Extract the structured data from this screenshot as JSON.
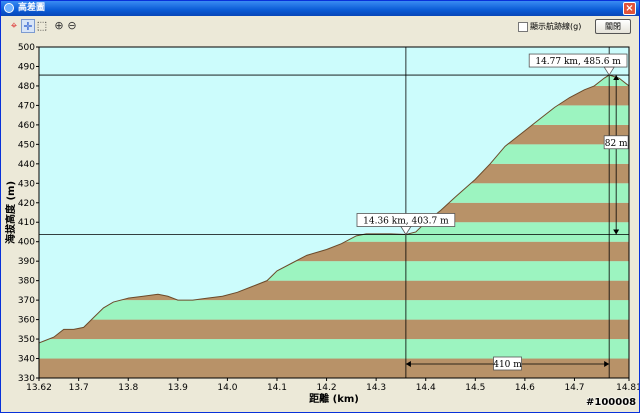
{
  "window": {
    "title": "高差圖",
    "close_glyph": "×"
  },
  "toolbar": {
    "tools": [
      {
        "name": "crosshair-red-icon",
        "glyph": "⌖"
      },
      {
        "name": "crosshair-blue-icon",
        "glyph": "✛"
      },
      {
        "name": "select-region-icon",
        "glyph": "⬚"
      },
      {
        "name": "zoom-in-icon",
        "glyph": "⊕"
      },
      {
        "name": "zoom-out-icon",
        "glyph": "⊖"
      }
    ],
    "checkbox_label": "顯示航跡線(g)",
    "close_label": "關閉"
  },
  "watermark": "#100008",
  "colors": {
    "sky": "#ccfcfc",
    "band_brown": "#b89268",
    "band_green": "#9cf4c0",
    "terrain_edge": "#6b4a2a"
  },
  "chart_data": {
    "type": "area",
    "title": "",
    "xlabel": "距離 (km)",
    "ylabel": "海拔高度 (m)",
    "xlim": [
      13.62,
      14.81
    ],
    "ylim": [
      330,
      500
    ],
    "xticks": [
      13.62,
      13.7,
      13.8,
      13.9,
      14.0,
      14.1,
      14.2,
      14.3,
      14.4,
      14.5,
      14.6,
      14.7,
      14.81
    ],
    "yticks": [
      330,
      340,
      350,
      360,
      370,
      380,
      390,
      400,
      410,
      420,
      430,
      440,
      450,
      460,
      470,
      480,
      490,
      500
    ],
    "band_interval": 10,
    "series": [
      {
        "x": [
          13.62,
          13.63,
          13.65,
          13.665,
          13.67,
          13.69,
          13.71,
          13.73,
          13.75,
          13.77,
          13.8,
          13.83,
          13.86,
          13.88,
          13.9,
          13.93,
          13.96,
          13.99,
          14.02,
          14.05,
          14.08,
          14.1,
          14.13,
          14.16,
          14.2,
          14.23,
          14.26,
          14.28,
          14.3,
          14.33,
          14.36,
          14.38,
          14.4,
          14.43,
          14.46,
          14.5,
          14.53,
          14.56,
          14.6,
          14.63,
          14.66,
          14.69,
          14.72,
          14.74,
          14.76,
          14.77,
          14.79,
          14.81
        ],
        "y": [
          348,
          349,
          351,
          354,
          355,
          355,
          356,
          361,
          366,
          369,
          371,
          372,
          373,
          372,
          370,
          370,
          371,
          372,
          374,
          377,
          380,
          385,
          389,
          393,
          396,
          399,
          403,
          404,
          404,
          404,
          403.7,
          405,
          410,
          416,
          423,
          432,
          440,
          449,
          457,
          463,
          469,
          474,
          478,
          480,
          484,
          485.6,
          484,
          480
        ]
      }
    ],
    "crosshairs": [
      {
        "x": 14.36,
        "y": 403.7,
        "label": "14.36 km, 403.7 m"
      },
      {
        "x": 14.77,
        "y": 485.6,
        "label": "14.77 km, 485.6 m"
      }
    ],
    "distance_measure": {
      "from": 14.36,
      "to": 14.77,
      "label": "410 m"
    },
    "height_measure": {
      "from": 403.7,
      "to": 485.6,
      "label": "82 m"
    }
  }
}
